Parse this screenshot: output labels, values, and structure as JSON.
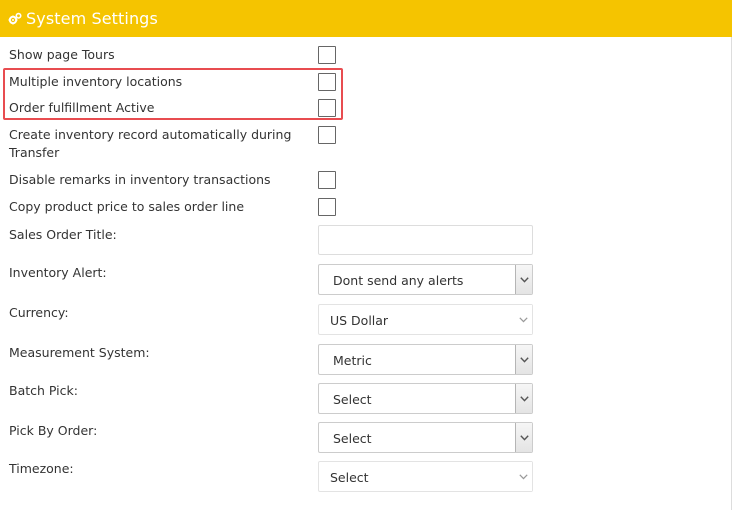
{
  "header": {
    "title": "System Settings",
    "icon": "gears-icon"
  },
  "settings": {
    "show_page_tours": "Show page Tours",
    "multiple_inventory_locations": "Multiple inventory locations",
    "order_fulfillment_active": "Order fulfillment Active",
    "create_inventory_record": "Create inventory record automatically during Transfer",
    "disable_remarks": "Disable remarks in inventory transactions",
    "copy_product_price": "Copy product price to sales order line",
    "sales_order_title": "Sales Order Title:",
    "inventory_alert": "Inventory Alert:",
    "currency": "Currency:",
    "measurement_system": "Measurement System:",
    "batch_pick": "Batch Pick:",
    "pick_by_order": "Pick By Order:",
    "timezone": "Timezone:"
  },
  "values": {
    "sales_order_title": "",
    "inventory_alert": "Dont send any alerts",
    "currency": "US Dollar",
    "measurement_system": "Metric",
    "batch_pick": "Select",
    "pick_by_order": "Select",
    "timezone": "Select"
  },
  "colors": {
    "header_bg": "#f5c400",
    "highlight": "#e84c50"
  }
}
